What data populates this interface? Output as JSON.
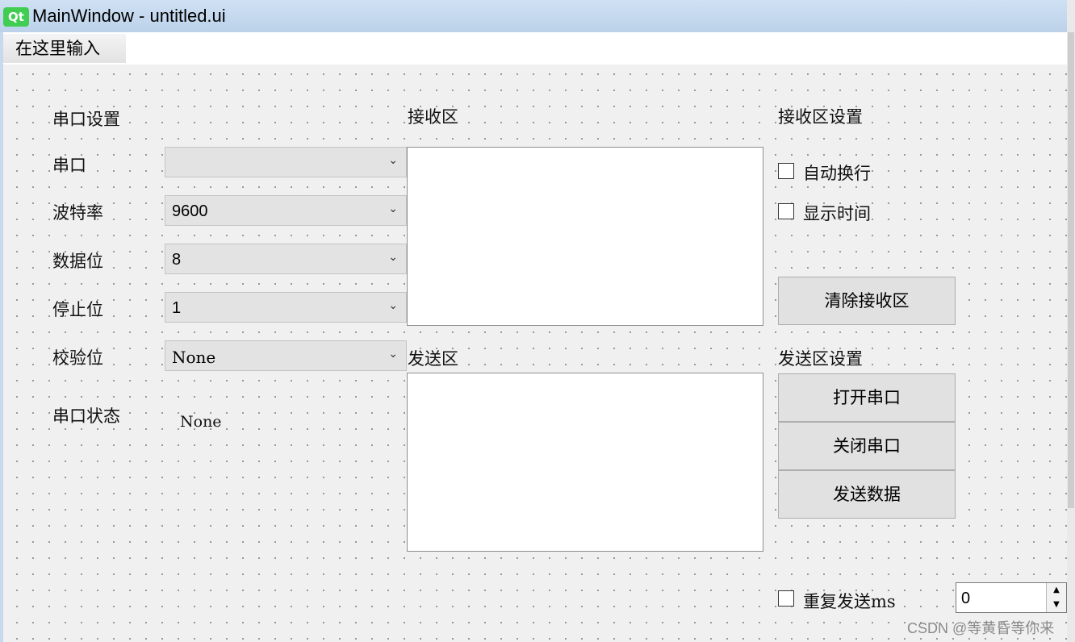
{
  "window": {
    "logo_text": "Qt",
    "title": "MainWindow - untitled.ui"
  },
  "menu": {
    "items": [
      {
        "label": "在这里输入"
      }
    ]
  },
  "serial_settings": {
    "group_label": "串口设置",
    "port": {
      "label": "串口",
      "value": ""
    },
    "baud_rate": {
      "label": "波特率",
      "value": "9600"
    },
    "data_bits": {
      "label": "数据位",
      "value": "8"
    },
    "stop_bits": {
      "label": "停止位",
      "value": "1"
    },
    "parity": {
      "label": "校验位",
      "value": "None"
    },
    "status": {
      "label": "串口状态",
      "value": "None"
    }
  },
  "receive_area": {
    "label": "接收区",
    "content": ""
  },
  "send_area": {
    "label": "发送区",
    "content": ""
  },
  "receive_settings": {
    "label": "接收区设置",
    "auto_wrap": {
      "label": "自动换行",
      "checked": false
    },
    "show_time": {
      "label": "显示时间",
      "checked": false
    },
    "clear_button": "清除接收区"
  },
  "send_settings": {
    "label": "发送区设置",
    "open_button": "打开串口",
    "close_button": "关闭串口",
    "send_button": "发送数据",
    "repeat": {
      "label": "重复发送ms",
      "checked": false,
      "interval": "0"
    }
  },
  "watermark": "CSDN @等黄昏等你来",
  "icons": {
    "dropdown": "chevron-down-icon",
    "spin_up": "caret-up-icon",
    "spin_down": "caret-down-icon"
  }
}
